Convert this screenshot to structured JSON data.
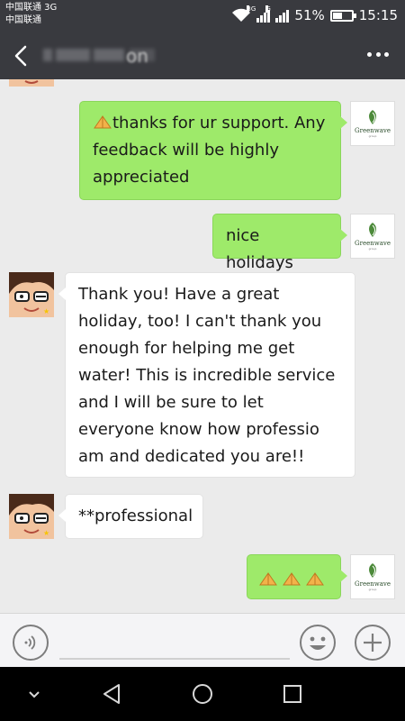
{
  "status_bar": {
    "carrier_line1": "中国联通 3G",
    "carrier_line2": "中国联通",
    "net1": "3G",
    "net2": "G",
    "battery": "51%",
    "battery_level": 0.51,
    "time": "15:15"
  },
  "header": {
    "contact_name_obscured": "on",
    "back_icon": "back-arrow-icon",
    "more_icon": "more-dots-icon"
  },
  "logo": {
    "name": "Greenwave",
    "sub": "group"
  },
  "messages": [
    {
      "sender": "me",
      "text": "thanks for ur support. Any feedback will be highly appreciated",
      "has_emoji_prefix": true
    },
    {
      "sender": "me",
      "text": "nice holidays"
    },
    {
      "sender": "them",
      "text": "Thank you! Have a great holiday, too! I can't thank you enough for helping me get water! This is incredible service and I will be sure to let everyone know how professio am and dedicated you are!!"
    },
    {
      "sender": "them",
      "text": "**professional"
    },
    {
      "sender": "me",
      "text": "",
      "emoji_count": 3
    }
  ],
  "input_bar": {
    "voice_icon": "voice-icon",
    "emoji_icon": "smiley-icon",
    "plus_icon": "plus-icon",
    "message_value": ""
  },
  "nav_bar": {
    "icons": [
      "chevron-down-icon",
      "back-triangle-icon",
      "home-circle-icon",
      "recents-square-icon"
    ]
  },
  "colors": {
    "bar_dark": "#393a3f",
    "chat_bg": "#ebebeb",
    "my_bubble": "#9eea6a",
    "their_bubble": "#ffffff"
  }
}
